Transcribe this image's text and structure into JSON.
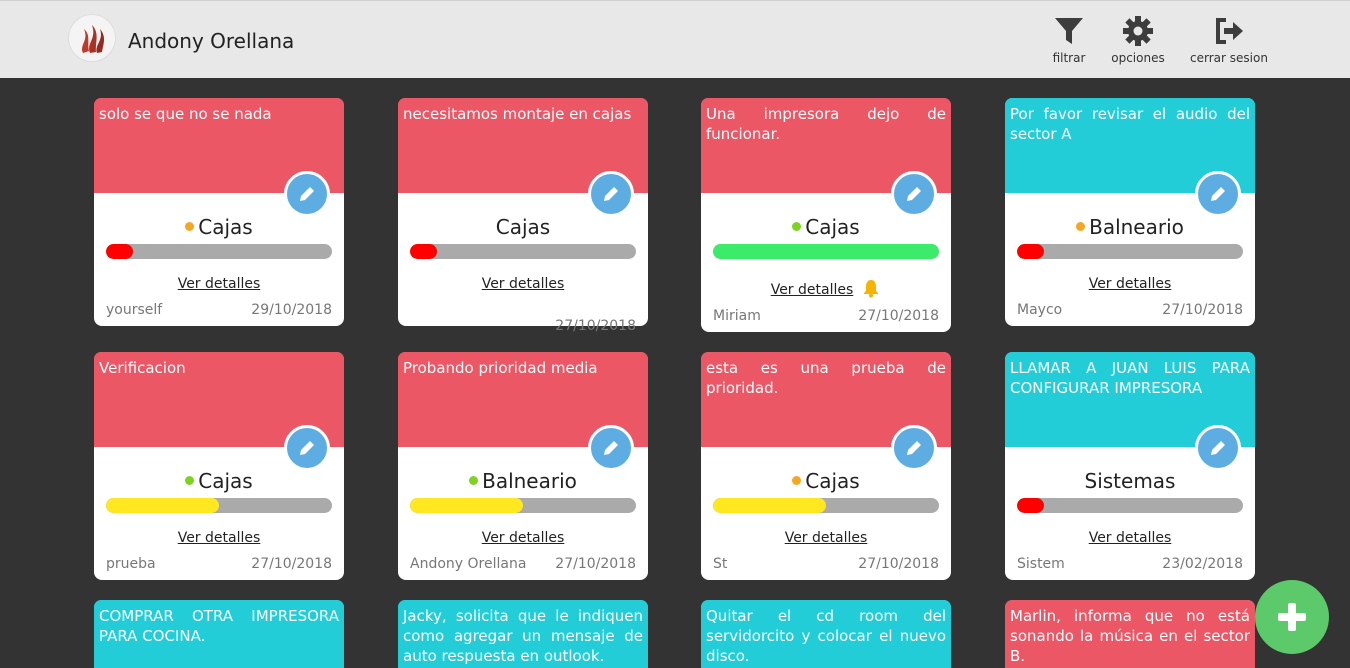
{
  "header": {
    "user_name": "Andony Orellana",
    "nav": {
      "filter_label": "filtrar",
      "options_label": "opciones",
      "logout_label": "cerrar sesion"
    }
  },
  "cards": [
    {
      "text": "solo se que no se nada",
      "color": "#ec5766",
      "category": "Cajas",
      "dot_color": "#f5a623",
      "progress": 0.12,
      "progress_color": "#ff0000",
      "details": "Ver detalles",
      "user": "yourself",
      "date": "29/10/2018"
    },
    {
      "text": "necesitamos montaje en cajas",
      "color": "#ec5766",
      "category": "Cajas",
      "dot_color": "",
      "progress": 0.12,
      "progress_color": "#ff0000",
      "details": "Ver detalles",
      "user": "",
      "date": "27/10/2018"
    },
    {
      "text": "Una impresora dejo de funcionar.",
      "color": "#ec5766",
      "category": "Cajas",
      "dot_color": "#7ed321",
      "progress": 1.0,
      "progress_color": "#3deb6a",
      "details": "Ver detalles",
      "bell": true,
      "user": "Miriam",
      "date": "27/10/2018"
    },
    {
      "text": "Por favor revisar el audio del sector A",
      "color": "#22cdd8",
      "category": "Balneario",
      "dot_color": "#f5a623",
      "progress": 0.12,
      "progress_color": "#ff0000",
      "details": "Ver detalles",
      "user": "Mayco",
      "date": "27/10/2018"
    },
    {
      "text": "Verificacion",
      "color": "#ec5766",
      "category": "Cajas",
      "dot_color": "#7ed321",
      "progress": 0.5,
      "progress_color": "#ffe81f",
      "details": "Ver detalles",
      "user": "prueba",
      "date": "27/10/2018"
    },
    {
      "text": "Probando prioridad media",
      "color": "#ec5766",
      "category": "Balneario",
      "dot_color": "#7ed321",
      "progress": 0.5,
      "progress_color": "#ffe81f",
      "details": "Ver detalles",
      "user": "Andony Orellana",
      "date": "27/10/2018"
    },
    {
      "text": "esta es una prueba de prioridad.",
      "color": "#ec5766",
      "category": "Cajas",
      "dot_color": "#f5a623",
      "progress": 0.5,
      "progress_color": "#ffe81f",
      "details": "Ver detalles",
      "user": "St",
      "date": "27/10/2018"
    },
    {
      "text": "LLAMAR A JUAN LUIS PARA CONFIGURAR IMPRESORA",
      "color": "#22cdd8",
      "category": "Sistemas",
      "dot_color": "",
      "progress": 0.12,
      "progress_color": "#ff0000",
      "details": "Ver detalles",
      "user": "Sistem",
      "date": "23/02/2018"
    },
    {
      "text": "COMPRAR OTRA IMPRESORA PARA COCINA.",
      "color": "#22cdd8"
    },
    {
      "text": "Jacky, solicita que le indiquen como agregar un mensaje de auto respuesta en outlook.",
      "color": "#22cdd8"
    },
    {
      "text": "Quitar el cd room del servidorcito y colocar el nuevo disco.",
      "color": "#22cdd8"
    },
    {
      "text": "Marlin, informa que no está sonando la música en el sector B.",
      "color": "#ec5766"
    }
  ],
  "fab": {
    "icon": "plus-icon"
  }
}
